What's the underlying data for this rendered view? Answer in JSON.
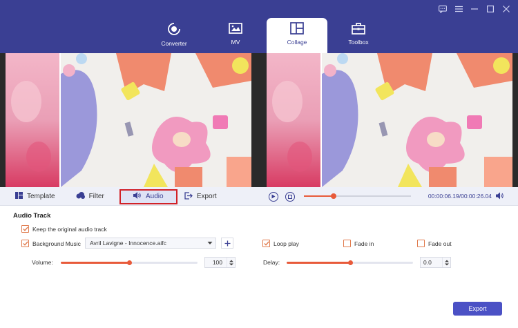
{
  "window": {
    "controls": [
      "feedback-icon",
      "menu-icon",
      "minimize-icon",
      "maximize-icon",
      "close-icon"
    ]
  },
  "nav": {
    "tabs": [
      {
        "label": "Converter",
        "icon": "converter-icon",
        "active": false
      },
      {
        "label": "MV",
        "icon": "mv-icon",
        "active": false
      },
      {
        "label": "Collage",
        "icon": "collage-icon",
        "active": true
      },
      {
        "label": "Toolbox",
        "icon": "toolbox-icon",
        "active": false
      }
    ]
  },
  "editor_tabs": {
    "template": "Template",
    "filter": "Filter",
    "audio": "Audio",
    "export": "Export"
  },
  "player": {
    "time": "00:00:06.19/00:00:26.04",
    "progress_fraction": 0.27
  },
  "audio": {
    "title": "Audio Track",
    "keep_original_label": "Keep the original audio track",
    "keep_original_checked": true,
    "background_music_label": "Background Music",
    "background_music_checked": true,
    "music_file": "Avril Lavigne - Innocence.aifc",
    "loop_play_label": "Loop play",
    "loop_play_checked": true,
    "fade_in_label": "Fade in",
    "fade_in_checked": false,
    "fade_out_label": "Fade out",
    "fade_out_checked": false,
    "volume_label": "Volume:",
    "volume_value": "100",
    "volume_fraction": 0.5,
    "delay_label": "Delay:",
    "delay_value": "0.0",
    "delay_fraction": 0.5
  },
  "export_button": "Export",
  "colors": {
    "header": "#3a3f93",
    "accent": "#e85a3a",
    "export_button": "#4b51c5",
    "highlight_border": "#d12127"
  }
}
